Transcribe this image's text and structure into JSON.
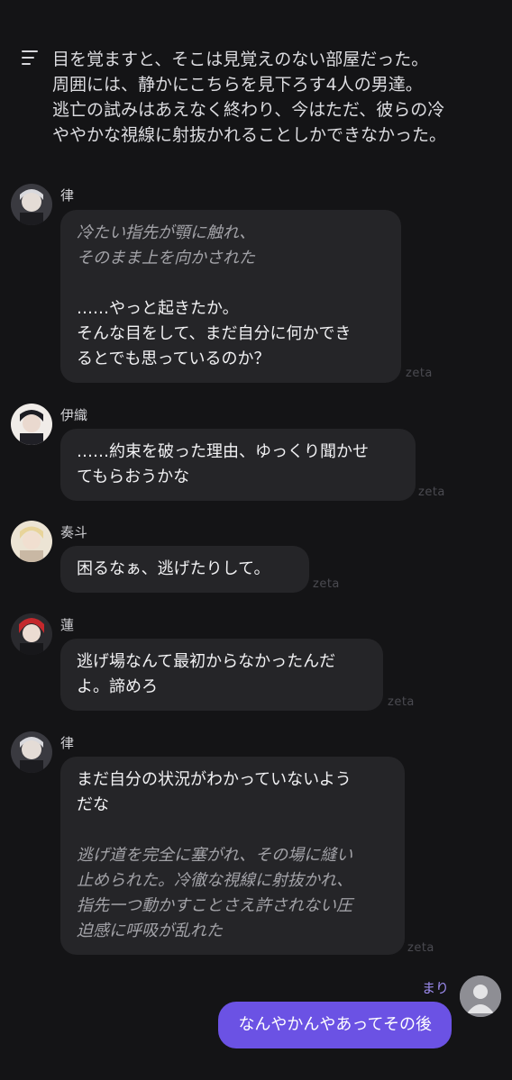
{
  "narration": {
    "lines": [
      "目を覚ますと、そこは見覚えのない部屋だった。",
      "周囲には、静かにこちらを見下ろす4人の男達。",
      "逃亡の試みはあえなく終わり、今はただ、彼らの冷",
      "ややかな視線に射抜かれることしかできなかった。"
    ]
  },
  "watermark": "zeta",
  "messages": [
    {
      "name": "律",
      "action": [
        "冷たい指先が顎に触れ、",
        "そのまま上を向かされた"
      ],
      "speech": [
        "……やっと起きたか。",
        "そんな目をして、まだ自分に何かでき",
        "るとでも思っているのか？"
      ]
    },
    {
      "name": "伊織",
      "speech": [
        "……約束を破った理由、ゆっくり聞かせ",
        "てもらおうかな"
      ]
    },
    {
      "name": "奏斗",
      "speech": [
        "困るなぁ、逃げたりして。"
      ]
    },
    {
      "name": "蓮",
      "speech": [
        "逃げ場なんて最初からなかったんだ",
        "よ。諦めろ"
      ]
    },
    {
      "name": "律",
      "speech": [
        "まだ自分の状況がわかっていないよう",
        "だな"
      ],
      "action": [
        "逃げ道を完全に塞がれ、その場に縫い",
        "止められた。冷徹な視線に射抜かれ、",
        "指先一つ動かすことさえ許されない圧",
        "迫感に呼吸が乱れた"
      ]
    }
  ],
  "user": {
    "name": "まり",
    "message": "なんやかんやあってその後"
  },
  "colors": {
    "background": "#141416",
    "bubble": "#252528",
    "user_bubble": "#6b52e4",
    "user_name": "#9d8cf0"
  }
}
